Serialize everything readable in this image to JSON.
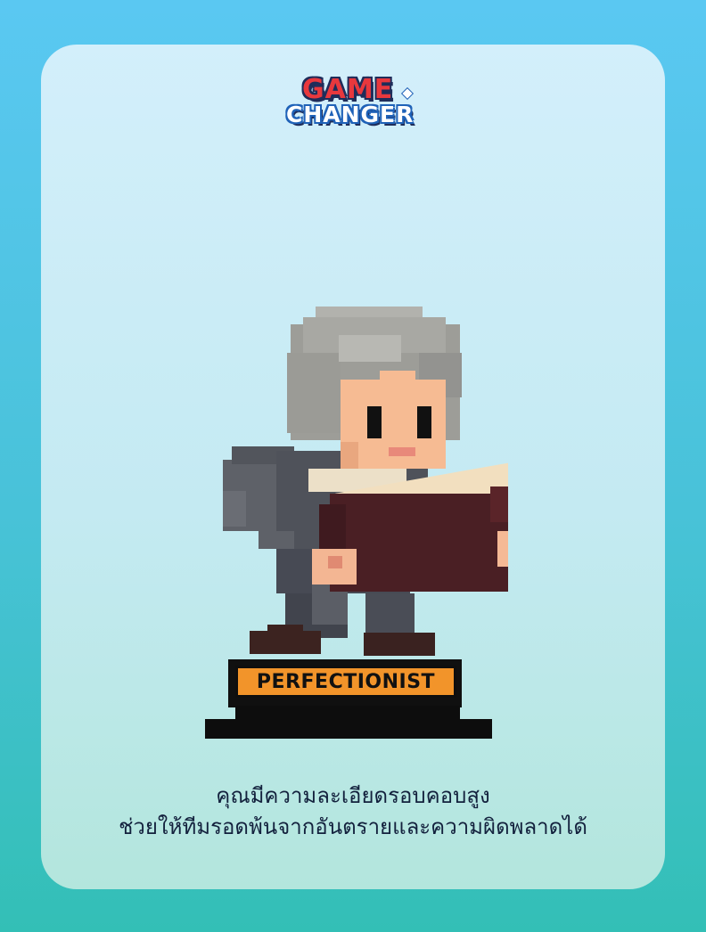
{
  "logo": {
    "line1": "GAME",
    "line2": "CHANGER"
  },
  "card": {
    "character_name": "PERFECTIONIST",
    "description_line1": "คุณมีความละเอียดรอบคอบสูง",
    "description_line2": "ช่วยให้ทีมรอดพ้นจากอันตรายและความผิดพลาดได้"
  },
  "colors": {
    "background": "#4cc4dc",
    "card": "#c8ecf4",
    "nameplate": "#f2942a",
    "text": "#13213d",
    "hair": "#a8a8a3",
    "skin": "#f6bb93",
    "book": "#4a1f24",
    "coat": "#55585f"
  },
  "icons": {
    "character": "pixel-old-man-reading-book",
    "logo": "game-changer-logo"
  }
}
